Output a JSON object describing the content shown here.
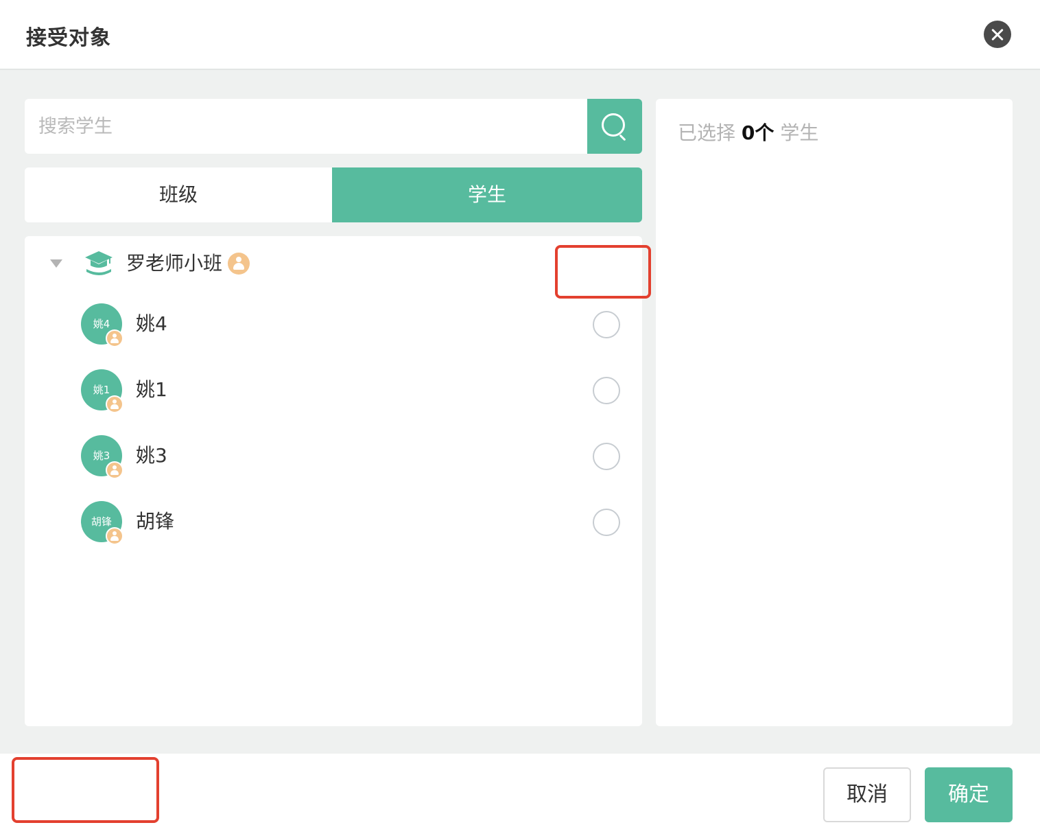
{
  "dialog": {
    "title": "接受对象",
    "close_icon": "close-icon"
  },
  "search": {
    "placeholder": "搜索学生",
    "value": "",
    "icon": "search-icon"
  },
  "tabs": [
    {
      "label": "班级",
      "active": false
    },
    {
      "label": "学生",
      "active": true
    }
  ],
  "tree": {
    "group": {
      "name": "罗老师小班",
      "expanded": true,
      "icon": "graduation-cap-icon",
      "badge_icon": "person-badge-icon"
    },
    "students": [
      {
        "avatar_text": "姚4",
        "name": "姚4",
        "selected": false
      },
      {
        "avatar_text": "姚1",
        "name": "姚1",
        "selected": false
      },
      {
        "avatar_text": "姚3",
        "name": "姚3",
        "selected": false
      },
      {
        "avatar_text": "胡锋",
        "name": "胡锋",
        "selected": false
      }
    ]
  },
  "selected_panel": {
    "prefix": "已选择",
    "count": "0个",
    "suffix": "学生"
  },
  "footer": {
    "cancel_label": "取消",
    "ok_label": "确定"
  },
  "colors": {
    "accent": "#57bb9e",
    "badge": "#f4c48c",
    "highlight": "#e3402f",
    "background": "#eff1f0"
  }
}
